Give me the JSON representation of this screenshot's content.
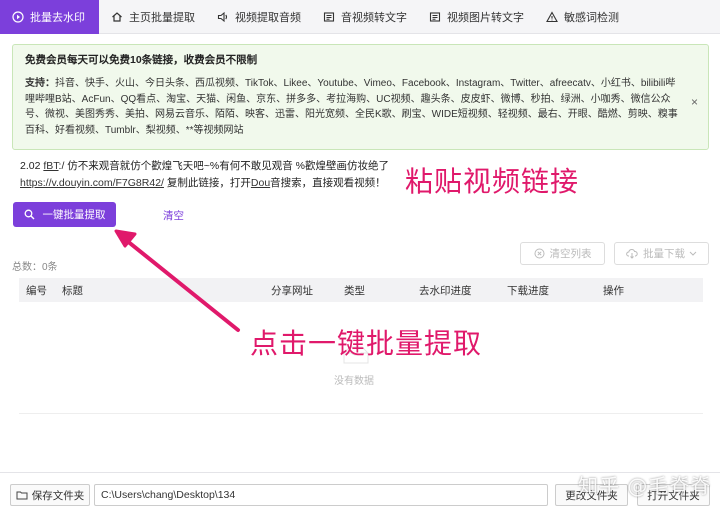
{
  "tabs": [
    {
      "label": "批量去水印",
      "icon": "play-circle-icon",
      "active": true
    },
    {
      "label": "主页批量提取",
      "icon": "home-icon",
      "active": false
    },
    {
      "label": "视频提取音频",
      "icon": "speaker-icon",
      "active": false
    },
    {
      "label": "音视频转文字",
      "icon": "text-doc-icon",
      "active": false
    },
    {
      "label": "视频图片转文字",
      "icon": "image-text-icon",
      "active": false
    },
    {
      "label": "敏感词检测",
      "icon": "warning-icon",
      "active": false
    }
  ],
  "notice": {
    "headline": "免费会员每天可以免费10条链接，收费会员不限制",
    "support_label": "支持：",
    "support_text": "抖音、快手、火山、今日头条、西瓜视频、TikTok、Likee、Youtube、Vimeo、Facebook、Instagram、Twitter、afreecatv、小红书、bilibili哔哩哔哩B站、AcFun、QQ看点、淘宝、天猫、闲鱼、京东、拼多多、考拉海购、UC视频、趣头条、皮皮虾、微博、秒拍、绿洲、小咖秀、微信公众号、微视、美图秀秀、美拍、网易云音乐、陌陌、映客、迅雷、阳光宽频、全民K歌、刷宝、WIDE短视频、轻视频、最右、开眼、酷燃、剪映、糗事百科、好看视频、Tumblr、梨视频、**等视频网站",
    "close": "×"
  },
  "input": {
    "line1_prefix": "2.02 ",
    "line1_code": "fBT",
    "line1_rest": ":/ 仿不来观音就仿个歡煌飞天吧~%有何不敢见观音 %歡煌壁画仿妆绝了",
    "line2_url": "https://v.douyin.com/F7G8R42/",
    "line2_rest_a": " 复制此链接，打开",
    "line2_dou": "Dou",
    "line2_rest_b": "音搜索，直接观看视频！"
  },
  "overlay_paste": "粘贴视频链接",
  "overlay_click": "点击一键批量提取",
  "buttons": {
    "extract": "一键批量提取",
    "clear": "清空",
    "clear_list": "清空列表",
    "batch_download": "批量下载"
  },
  "count_text": "总数：0条",
  "table": {
    "headers": [
      "编号",
      "标题",
      "分享网址",
      "类型",
      "去水印进度",
      "下载进度",
      "操作"
    ],
    "empty": "没有数据"
  },
  "bottom": {
    "save_folder": "保存文件夹",
    "path": "C:\\Users\\chang\\Desktop\\134",
    "change_folder": "更改文件夹",
    "open_folder": "打开文件夹"
  },
  "watermark": "知乎 @毛脊脊",
  "colors": {
    "accent": "#7c3fdb",
    "annotation": "#e0196b",
    "notice_bg": "#f1f9ec"
  }
}
